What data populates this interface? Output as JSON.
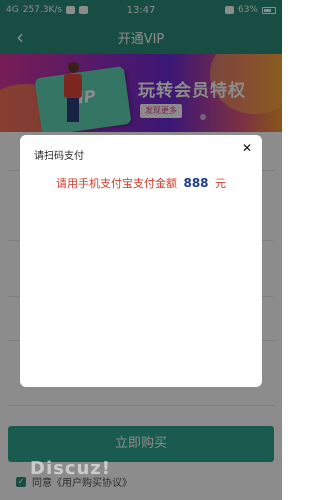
{
  "status_bar": {
    "network": "4G",
    "speed": "257.3K/s",
    "time": "13:47",
    "battery": "63%"
  },
  "header": {
    "title": "开通VIP"
  },
  "banner": {
    "card_label": "VIP",
    "title": "玩转会员特权",
    "button_label": "发现更多"
  },
  "page": {
    "buy_button_label": "立即购买",
    "agree_text": "同意《用户购买协议》"
  },
  "dialog": {
    "title": "请扫码支付",
    "message_prefix": "请用手机支付宝支付金额",
    "amount": "888",
    "unit": "元"
  },
  "watermark": "Discuz!"
}
